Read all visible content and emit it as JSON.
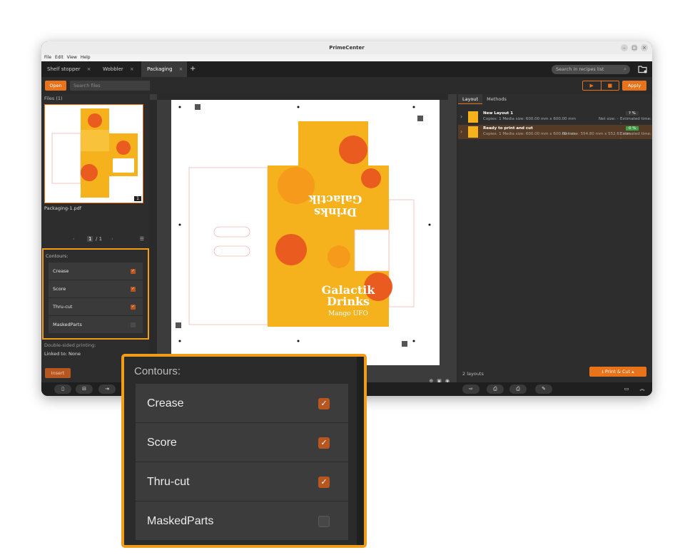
{
  "window": {
    "title": "PrimeCenter"
  },
  "menu": [
    "File",
    "Edit",
    "View",
    "Help"
  ],
  "tabs": [
    {
      "label": "Shelf stopper"
    },
    {
      "label": "Wobbler"
    },
    {
      "label": "Packaging"
    }
  ],
  "search_recipes": {
    "placeholder": "Search in recipes list"
  },
  "toolbar": {
    "open": "Open",
    "search_files": "Search files",
    "apply": "Apply"
  },
  "files": {
    "label": "Files (1)",
    "thumb_name": "Packaging-1.pdf",
    "thumb_page": "1",
    "page": "1",
    "total": "/ 1"
  },
  "contours": {
    "title": "Contours:",
    "items": [
      {
        "label": "Crease",
        "checked": true
      },
      {
        "label": "Score",
        "checked": true
      },
      {
        "label": "Thru-cut",
        "checked": true
      },
      {
        "label": "MaskedParts",
        "checked": false
      }
    ]
  },
  "double_sided": {
    "label": "Double-sided printing:",
    "linked": "Linked to: None"
  },
  "insert": "Insert",
  "right": {
    "tabs": [
      "Layout",
      "Methods"
    ],
    "layouts": [
      {
        "name": "New Layout 1",
        "meta": "Copies: 1    Media size: 600.00 mm x 600.00 mm",
        "net": "Net size: -",
        "pct": "? %",
        "est": "Estimated time: -"
      },
      {
        "name": "Ready to print and cut",
        "meta": "Copies: 1    Media size: 600.00 mm x 600.00 mm",
        "net": "Net size: 554.80 mm x 552.61 mm",
        "pct": "0 %",
        "est": "Estimated time: -"
      }
    ],
    "count": "2 layouts",
    "print_cut": "Print & Cut"
  },
  "colors": {
    "accent": "#e8731a",
    "highlight": "#f29d19",
    "check": "#b8561f",
    "dark": "#2b2b2b"
  }
}
